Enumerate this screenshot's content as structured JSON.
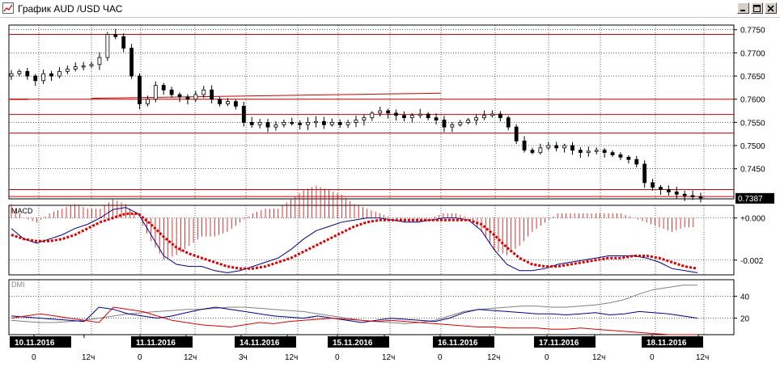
{
  "window": {
    "title": "График AUD /USD  ЧАС",
    "buttons": {
      "minimize": "minimize",
      "maximize": "maximize",
      "close": "close"
    }
  },
  "price_panel": {
    "current_price_label": "0.7387",
    "y_ticks": [
      "0.7750",
      "0.7700",
      "0.7650",
      "0.7600",
      "0.7550",
      "0.7500",
      "0.7450"
    ],
    "y_tick_values": [
      0.775,
      0.77,
      0.765,
      0.76,
      0.755,
      0.75,
      0.745
    ],
    "levels": [
      0.774,
      0.76,
      0.7567,
      0.7527,
      0.7405,
      0.739
    ],
    "level_color": "#cc0000"
  },
  "macd_panel": {
    "label": "MACD",
    "y_ticks": [
      "+0.000",
      "-0.002"
    ],
    "y_tick_values": [
      0.0,
      -0.002
    ],
    "line_color": "#00008b",
    "signal_color": "#dd0000",
    "hist_color": "#dd0000"
  },
  "dmi_panel": {
    "label": "DMI",
    "y_ticks": [
      "40",
      "20"
    ],
    "y_tick_values": [
      40,
      20
    ],
    "adx_color": "#808080",
    "plus_di_color": "#00008b",
    "minus_di_color": "#dd0000"
  },
  "time_axis": {
    "dates": [
      "10.11.2016",
      "11.11.2016",
      "14.11.2016",
      "15.11.2016",
      "16.11.2016",
      "17.11.2016",
      "18.11.2016"
    ],
    "hours": [
      "0",
      "12ч",
      "0",
      "12ч",
      "3ч",
      "12ч",
      "0",
      "12ч",
      "0",
      "12ч",
      "0",
      "12ч",
      "0",
      "12ч"
    ]
  },
  "chart_data": {
    "type": "line",
    "title": "График AUD /USD  ЧАС",
    "price_ylim": [
      0.7385,
      0.776
    ],
    "last_price": 0.7387,
    "horizontal_levels": [
      0.774,
      0.76,
      0.7567,
      0.7527,
      0.7405,
      0.739
    ],
    "close_series": [
      0.7655,
      0.766,
      0.765,
      0.764,
      0.7655,
      0.765,
      0.766,
      0.7665,
      0.767,
      0.7672,
      0.7675,
      0.769,
      0.774,
      0.7735,
      0.771,
      0.765,
      0.759,
      0.76,
      0.763,
      0.762,
      0.761,
      0.7605,
      0.76,
      0.761,
      0.762,
      0.76,
      0.759,
      0.7595,
      0.7585,
      0.755,
      0.7545,
      0.755,
      0.754,
      0.7545,
      0.755,
      0.7548,
      0.7545,
      0.755,
      0.7552,
      0.7545,
      0.755,
      0.7545,
      0.755,
      0.7555,
      0.756,
      0.757,
      0.7575,
      0.757,
      0.7565,
      0.756,
      0.7565,
      0.7568,
      0.756,
      0.7555,
      0.754,
      0.7545,
      0.755,
      0.7555,
      0.756,
      0.7565,
      0.7568,
      0.756,
      0.754,
      0.751,
      0.749,
      0.7485,
      0.7495,
      0.75,
      0.7495,
      0.75,
      0.749,
      0.7485,
      0.7488,
      0.749,
      0.7485,
      0.748,
      0.7475,
      0.747,
      0.746,
      0.742,
      0.741,
      0.7405,
      0.74,
      0.7395,
      0.7392,
      0.739,
      0.7387
    ],
    "macd_ylim": [
      -0.0027,
      0.0006
    ],
    "macd_series": [
      -0.0005,
      -0.001,
      -0.0012,
      -0.001,
      -0.0008,
      -0.0005,
      -0.0003,
      0.0,
      0.0004,
      0.0005,
      0.0002,
      -0.0008,
      -0.0018,
      -0.0022,
      -0.0023,
      -0.0023,
      -0.0025,
      -0.0026,
      -0.0025,
      -0.0023,
      -0.0021,
      -0.0019,
      -0.0015,
      -0.001,
      -0.0006,
      -0.0004,
      -0.0002,
      -0.0001,
      0.0,
      0.0,
      -0.0001,
      -0.0002,
      -0.0002,
      -0.0001,
      0.0,
      0.0,
      -0.0001,
      -0.0006,
      -0.0015,
      -0.0022,
      -0.0025,
      -0.0025,
      -0.0024,
      -0.0022,
      -0.0021,
      -0.002,
      -0.0019,
      -0.0018,
      -0.0018,
      -0.0018,
      -0.0019,
      -0.0021,
      -0.0024,
      -0.0025,
      -0.0026
    ],
    "macd_signal_series": [
      -0.0008,
      -0.001,
      -0.0011,
      -0.0011,
      -0.001,
      -0.0008,
      -0.0005,
      -0.0002,
      0.0,
      0.0002,
      0.0002,
      -0.0003,
      -0.0009,
      -0.0014,
      -0.0017,
      -0.0019,
      -0.0021,
      -0.0023,
      -0.0024,
      -0.0024,
      -0.0023,
      -0.0021,
      -0.0019,
      -0.0016,
      -0.0013,
      -0.001,
      -0.0007,
      -0.0004,
      -0.0002,
      -0.0001,
      -0.0001,
      -0.0001,
      -0.0001,
      -0.0001,
      -0.0001,
      -0.0001,
      -0.0001,
      -0.0003,
      -0.0008,
      -0.0014,
      -0.0019,
      -0.0022,
      -0.0023,
      -0.0023,
      -0.0022,
      -0.0021,
      -0.002,
      -0.0019,
      -0.0019,
      -0.0018,
      -0.0018,
      -0.0019,
      -0.0021,
      -0.0023,
      -0.0024
    ],
    "dmi_ylim": [
      5,
      55
    ],
    "adx_series": [
      18,
      17,
      16,
      16,
      17,
      18,
      20,
      22,
      24,
      25,
      26,
      27,
      28,
      28,
      29,
      30,
      30,
      29,
      28,
      27,
      26,
      24,
      22,
      20,
      18,
      17,
      16,
      15,
      16,
      18,
      22,
      26,
      28,
      29,
      30,
      31,
      31,
      30,
      30,
      31,
      32,
      34,
      37,
      42,
      46,
      48,
      50,
      50
    ],
    "plus_di_series": [
      22,
      21,
      20,
      19,
      18,
      17,
      30,
      28,
      24,
      22,
      20,
      22,
      25,
      28,
      30,
      28,
      26,
      24,
      22,
      21,
      20,
      22,
      20,
      18,
      16,
      18,
      20,
      19,
      18,
      17,
      20,
      25,
      28,
      27,
      26,
      25,
      24,
      24,
      23,
      24,
      25,
      23,
      24,
      26,
      25,
      24,
      22,
      20
    ],
    "minus_di_series": [
      20,
      22,
      24,
      22,
      20,
      18,
      16,
      30,
      28,
      26,
      22,
      18,
      16,
      14,
      13,
      12,
      14,
      16,
      15,
      17,
      18,
      19,
      20,
      19,
      18,
      17,
      18,
      17,
      16,
      15,
      14,
      13,
      12,
      12,
      11,
      11,
      11,
      10,
      10,
      11,
      10,
      9,
      8,
      7,
      6,
      5,
      5,
      5
    ]
  }
}
